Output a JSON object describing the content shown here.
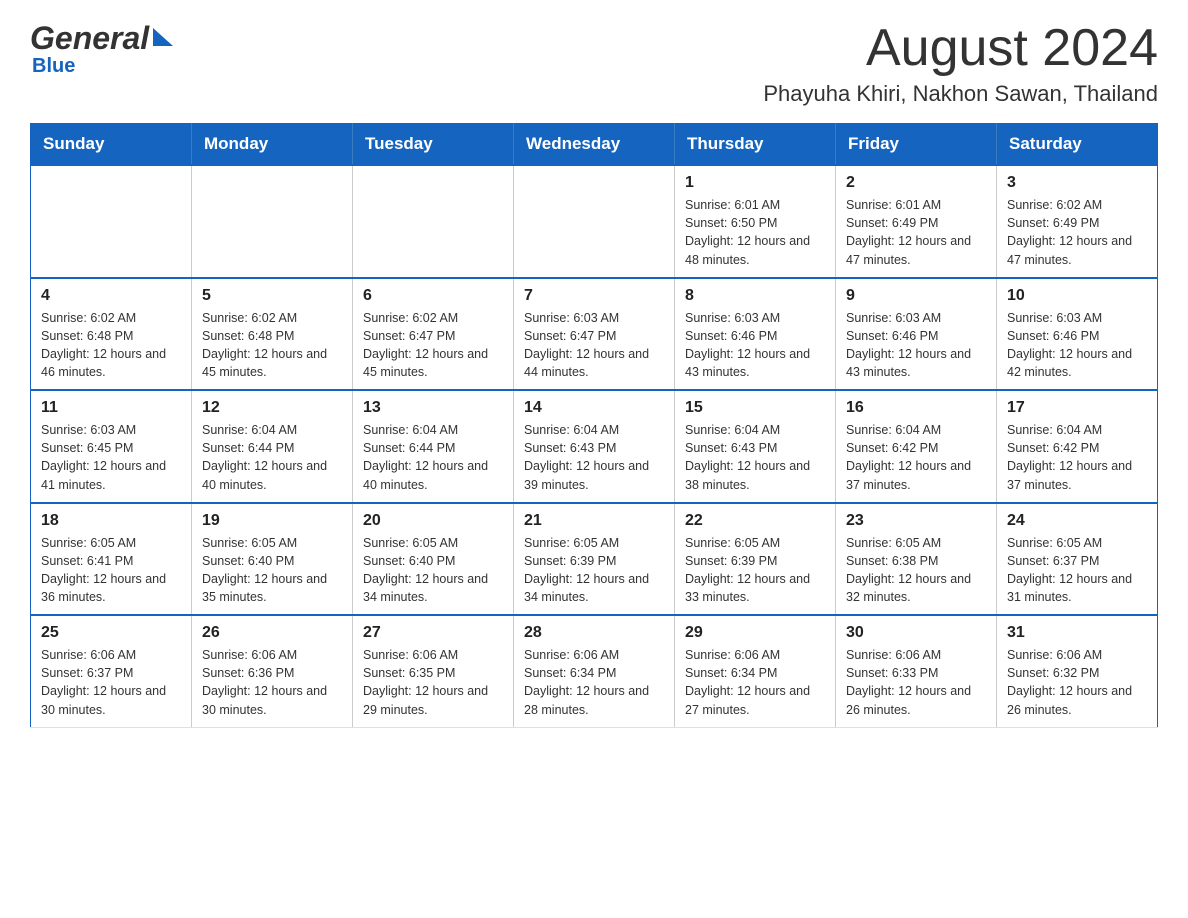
{
  "header": {
    "logo_general": "General",
    "logo_blue": "Blue",
    "title": "August 2024",
    "subtitle": "Phayuha Khiri, Nakhon Sawan, Thailand"
  },
  "calendar": {
    "days_of_week": [
      "Sunday",
      "Monday",
      "Tuesday",
      "Wednesday",
      "Thursday",
      "Friday",
      "Saturday"
    ],
    "weeks": [
      {
        "days": [
          {
            "num": "",
            "info": ""
          },
          {
            "num": "",
            "info": ""
          },
          {
            "num": "",
            "info": ""
          },
          {
            "num": "",
            "info": ""
          },
          {
            "num": "1",
            "info": "Sunrise: 6:01 AM\nSunset: 6:50 PM\nDaylight: 12 hours\nand 48 minutes."
          },
          {
            "num": "2",
            "info": "Sunrise: 6:01 AM\nSunset: 6:49 PM\nDaylight: 12 hours\nand 47 minutes."
          },
          {
            "num": "3",
            "info": "Sunrise: 6:02 AM\nSunset: 6:49 PM\nDaylight: 12 hours\nand 47 minutes."
          }
        ]
      },
      {
        "days": [
          {
            "num": "4",
            "info": "Sunrise: 6:02 AM\nSunset: 6:48 PM\nDaylight: 12 hours\nand 46 minutes."
          },
          {
            "num": "5",
            "info": "Sunrise: 6:02 AM\nSunset: 6:48 PM\nDaylight: 12 hours\nand 45 minutes."
          },
          {
            "num": "6",
            "info": "Sunrise: 6:02 AM\nSunset: 6:47 PM\nDaylight: 12 hours\nand 45 minutes."
          },
          {
            "num": "7",
            "info": "Sunrise: 6:03 AM\nSunset: 6:47 PM\nDaylight: 12 hours\nand 44 minutes."
          },
          {
            "num": "8",
            "info": "Sunrise: 6:03 AM\nSunset: 6:46 PM\nDaylight: 12 hours\nand 43 minutes."
          },
          {
            "num": "9",
            "info": "Sunrise: 6:03 AM\nSunset: 6:46 PM\nDaylight: 12 hours\nand 43 minutes."
          },
          {
            "num": "10",
            "info": "Sunrise: 6:03 AM\nSunset: 6:46 PM\nDaylight: 12 hours\nand 42 minutes."
          }
        ]
      },
      {
        "days": [
          {
            "num": "11",
            "info": "Sunrise: 6:03 AM\nSunset: 6:45 PM\nDaylight: 12 hours\nand 41 minutes."
          },
          {
            "num": "12",
            "info": "Sunrise: 6:04 AM\nSunset: 6:44 PM\nDaylight: 12 hours\nand 40 minutes."
          },
          {
            "num": "13",
            "info": "Sunrise: 6:04 AM\nSunset: 6:44 PM\nDaylight: 12 hours\nand 40 minutes."
          },
          {
            "num": "14",
            "info": "Sunrise: 6:04 AM\nSunset: 6:43 PM\nDaylight: 12 hours\nand 39 minutes."
          },
          {
            "num": "15",
            "info": "Sunrise: 6:04 AM\nSunset: 6:43 PM\nDaylight: 12 hours\nand 38 minutes."
          },
          {
            "num": "16",
            "info": "Sunrise: 6:04 AM\nSunset: 6:42 PM\nDaylight: 12 hours\nand 37 minutes."
          },
          {
            "num": "17",
            "info": "Sunrise: 6:04 AM\nSunset: 6:42 PM\nDaylight: 12 hours\nand 37 minutes."
          }
        ]
      },
      {
        "days": [
          {
            "num": "18",
            "info": "Sunrise: 6:05 AM\nSunset: 6:41 PM\nDaylight: 12 hours\nand 36 minutes."
          },
          {
            "num": "19",
            "info": "Sunrise: 6:05 AM\nSunset: 6:40 PM\nDaylight: 12 hours\nand 35 minutes."
          },
          {
            "num": "20",
            "info": "Sunrise: 6:05 AM\nSunset: 6:40 PM\nDaylight: 12 hours\nand 34 minutes."
          },
          {
            "num": "21",
            "info": "Sunrise: 6:05 AM\nSunset: 6:39 PM\nDaylight: 12 hours\nand 34 minutes."
          },
          {
            "num": "22",
            "info": "Sunrise: 6:05 AM\nSunset: 6:39 PM\nDaylight: 12 hours\nand 33 minutes."
          },
          {
            "num": "23",
            "info": "Sunrise: 6:05 AM\nSunset: 6:38 PM\nDaylight: 12 hours\nand 32 minutes."
          },
          {
            "num": "24",
            "info": "Sunrise: 6:05 AM\nSunset: 6:37 PM\nDaylight: 12 hours\nand 31 minutes."
          }
        ]
      },
      {
        "days": [
          {
            "num": "25",
            "info": "Sunrise: 6:06 AM\nSunset: 6:37 PM\nDaylight: 12 hours\nand 30 minutes."
          },
          {
            "num": "26",
            "info": "Sunrise: 6:06 AM\nSunset: 6:36 PM\nDaylight: 12 hours\nand 30 minutes."
          },
          {
            "num": "27",
            "info": "Sunrise: 6:06 AM\nSunset: 6:35 PM\nDaylight: 12 hours\nand 29 minutes."
          },
          {
            "num": "28",
            "info": "Sunrise: 6:06 AM\nSunset: 6:34 PM\nDaylight: 12 hours\nand 28 minutes."
          },
          {
            "num": "29",
            "info": "Sunrise: 6:06 AM\nSunset: 6:34 PM\nDaylight: 12 hours\nand 27 minutes."
          },
          {
            "num": "30",
            "info": "Sunrise: 6:06 AM\nSunset: 6:33 PM\nDaylight: 12 hours\nand 26 minutes."
          },
          {
            "num": "31",
            "info": "Sunrise: 6:06 AM\nSunset: 6:32 PM\nDaylight: 12 hours\nand 26 minutes."
          }
        ]
      }
    ]
  }
}
